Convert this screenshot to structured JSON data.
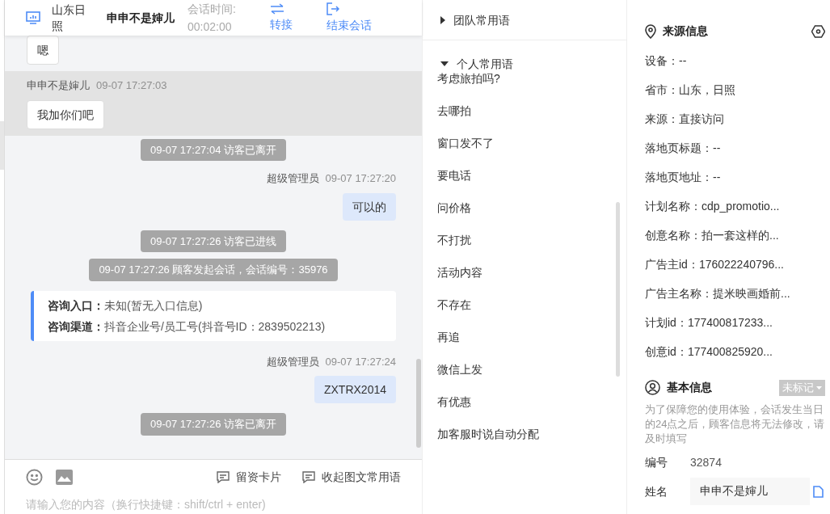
{
  "header": {
    "location": "山东日照",
    "visitor": "申申不是婶儿",
    "duration_label": "会话时间:",
    "duration": "00:02:00",
    "actions": [
      {
        "kind": "transfer",
        "label": "转接"
      },
      {
        "kind": "end",
        "label": "结束会话"
      }
    ]
  },
  "messages": [
    {
      "kind": "visitor",
      "text": "嗯",
      "highlighted": false
    },
    {
      "kind": "visitor",
      "sender": "申申不是婶儿",
      "time": "09-07 17:27:03",
      "text": "我加你们吧",
      "highlighted": true
    },
    {
      "kind": "system",
      "text": "09-07 17:27:04 访客已离开"
    },
    {
      "kind": "agent",
      "sender": "超级管理员",
      "time": "09-07 17:27:20",
      "text": "可以的"
    },
    {
      "kind": "system",
      "text": "09-07 17:27:26 访客已进线"
    },
    {
      "kind": "system",
      "text": "09-07 17:27:26 顾客发起会话，会话编号：35976"
    },
    {
      "kind": "info",
      "lines": [
        {
          "label": "咨询入口：",
          "value": "未知(暂无入口信息)"
        },
        {
          "label": "咨询渠道：",
          "value": "抖音企业号/员工号(抖音号ID：2839502213)"
        }
      ]
    },
    {
      "kind": "agent",
      "sender": "超级管理员",
      "time": "09-07 17:27:24",
      "text": "ZXTRX2014"
    },
    {
      "kind": "system",
      "text": "09-07 17:27:26 访客已离开"
    }
  ],
  "composer": {
    "placeholder": "请输入您的内容（换行快捷键：shift/ctrl + enter)",
    "buttons": [
      "留资卡片",
      "收起图文常用语"
    ]
  },
  "phrases": [
    {
      "label": "团队常用语",
      "expanded": false
    },
    {
      "label": "个人常用语",
      "expanded": true,
      "items": [
        "考虑旅拍吗?",
        "去哪拍",
        "窗口发不了",
        "要电话",
        "问价格",
        "不打扰",
        "活动内容",
        "不存在",
        "再追",
        "微信上发",
        "有优惠",
        "加客服时说自动分配"
      ]
    }
  ],
  "source_info": {
    "title": "来源信息",
    "fields": [
      "设备：--",
      "省市：山东，日照",
      "来源：直接访问",
      "落地页标题：--",
      "落地页地址：--",
      "计划名称：cdp_promotio...",
      "创意名称：拍一套这样的...",
      "广告主id：176022240796...",
      "广告主名称：提米映画婚前...",
      "计划id：177400817233...",
      "创意id：177400825920..."
    ]
  },
  "basic_info": {
    "title": "基本信息",
    "tag": "未标记",
    "note": "为了保障您的使用体验，会话发生当日的24点之后，顾客信息将无法修改，请及时填写",
    "fields": [
      {
        "kind": "text",
        "label": "编号",
        "value": "32874"
      },
      {
        "kind": "input",
        "label": "姓名",
        "value": "申申不是婶儿"
      }
    ]
  }
}
